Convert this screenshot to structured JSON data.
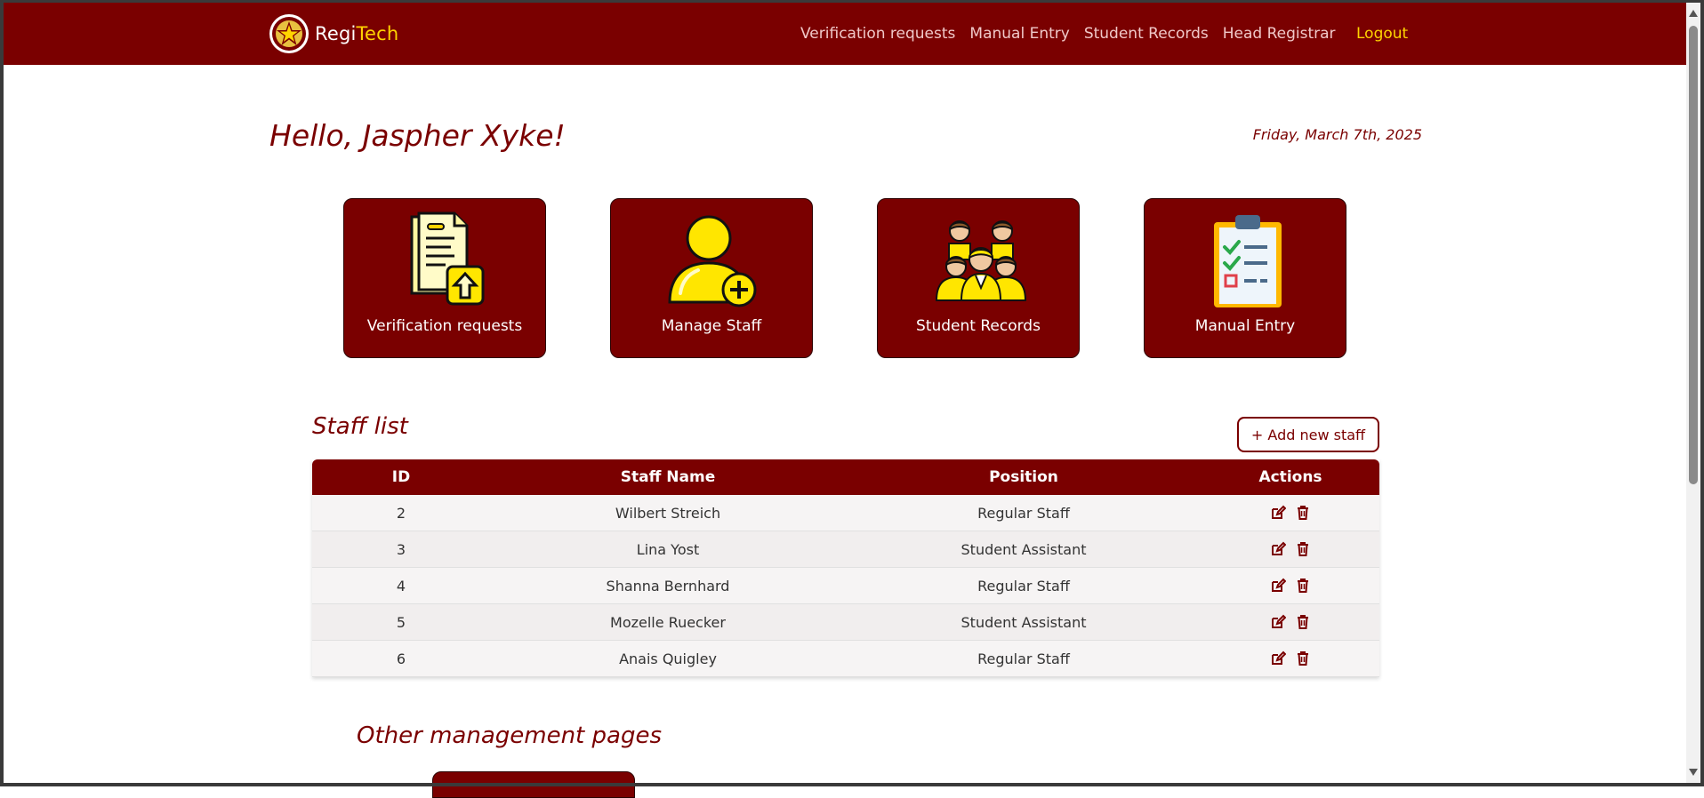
{
  "brand": {
    "name_part1": "Regi",
    "name_part2": "Tech"
  },
  "nav": {
    "links": [
      "Verification requests",
      "Manual Entry",
      "Student Records",
      "Head Registrar"
    ],
    "logout": "Logout"
  },
  "greeting": "Hello, Jaspher Xyke!",
  "date": "Friday, March 7th, 2025",
  "cards": [
    {
      "label": "Verification requests",
      "icon": "document-upload-icon"
    },
    {
      "label": "Manage Staff",
      "icon": "add-user-icon"
    },
    {
      "label": "Student Records",
      "icon": "students-group-icon"
    },
    {
      "label": "Manual Entry",
      "icon": "clipboard-checklist-icon"
    }
  ],
  "staff": {
    "title": "Staff list",
    "add_button": "+ Add new staff",
    "columns": [
      "ID",
      "Staff Name",
      "Position",
      "Actions"
    ],
    "rows": [
      {
        "id": "2",
        "name": "Wilbert Streich",
        "position": "Regular Staff"
      },
      {
        "id": "3",
        "name": "Lina Yost",
        "position": "Student Assistant"
      },
      {
        "id": "4",
        "name": "Shanna Bernhard",
        "position": "Regular Staff"
      },
      {
        "id": "5",
        "name": "Mozelle Ruecker",
        "position": "Student Assistant"
      },
      {
        "id": "6",
        "name": "Anais Quigley",
        "position": "Regular Staff"
      }
    ]
  },
  "other": {
    "title": "Other management pages"
  },
  "colors": {
    "primary": "#7a0000",
    "accent": "#ffd400"
  }
}
